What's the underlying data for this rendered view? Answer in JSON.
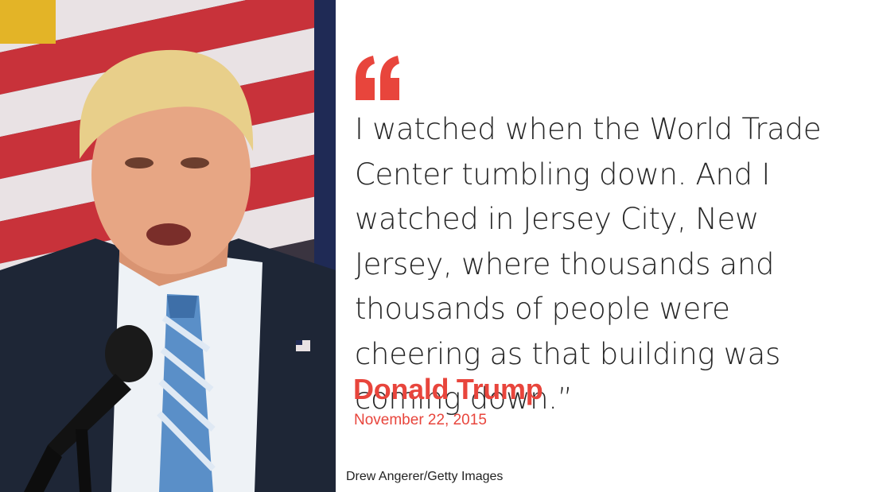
{
  "quote": {
    "mark_icon": "quote-mark-icon",
    "text": "I watched when the World Trade Center tumbling down. And I watched in Jersey City, New Jersey, where thousands and thousands of people were cheering as that building was coming down.”"
  },
  "speaker": {
    "name": "Donald Trump",
    "date": "November 22, 2015"
  },
  "photo": {
    "credit": "Drew Angerer/Getty Images"
  },
  "colors": {
    "accent": "#e8453c",
    "text": "#262626",
    "background": "#ffffff"
  }
}
